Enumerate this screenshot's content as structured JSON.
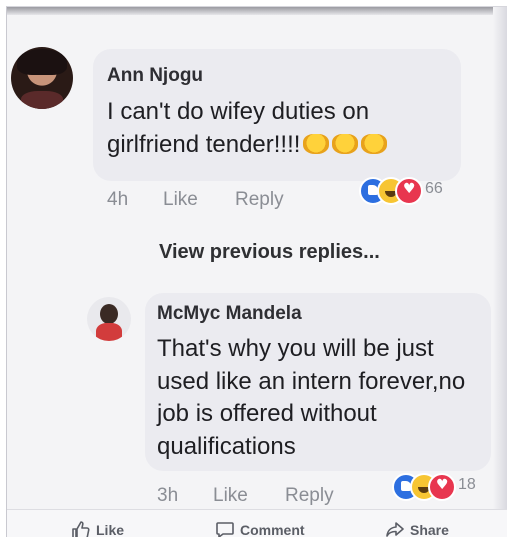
{
  "comments": [
    {
      "author": "Ann Njogu",
      "text": "I can't do wifey duties on girlfriend tender!!!!",
      "time": "4h",
      "like_label": "Like",
      "reply_label": "Reply",
      "reaction_count": "66"
    },
    {
      "author": "McMyc Mandela",
      "text": "That's why you will be just used like an intern forever,no job is offered without qualifications",
      "time": "3h",
      "like_label": "Like",
      "reply_label": "Reply",
      "reaction_count": "18"
    }
  ],
  "view_previous": "View previous replies...",
  "actions": {
    "like": "Like",
    "comment": "Comment",
    "share": "Share"
  },
  "colors": {
    "like_reaction": "#2d6fe0",
    "haha_reaction": "#f7c533",
    "love_reaction": "#e8364f"
  }
}
